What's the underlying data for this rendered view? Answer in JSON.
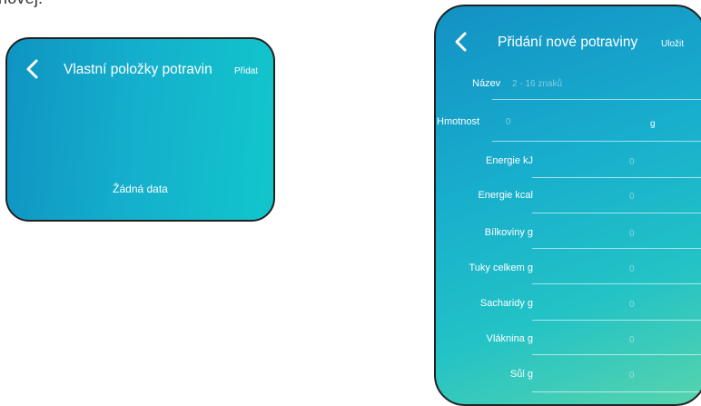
{
  "caption": "novej.",
  "left_screen": {
    "back_icon": "chevron-left-icon",
    "title": "Vlastní položky potravin",
    "action": "Přidat",
    "empty_message": "Žádná data"
  },
  "right_screen": {
    "back_icon": "chevron-left-icon",
    "title": "Přidání nové potraviny",
    "action": "Uložit",
    "name_field": {
      "label": "Název",
      "placeholder": "2 - 16 znaků"
    },
    "weight_field": {
      "label": "Hmotnost",
      "value": "0",
      "unit": "g"
    },
    "nutrients": [
      {
        "label": "Energie kJ",
        "value": "0"
      },
      {
        "label": "Energie kcal",
        "value": "0"
      },
      {
        "label": "Bílkoviny g",
        "value": "0"
      },
      {
        "label": "Tuky celkem g",
        "value": "0"
      },
      {
        "label": "Sacharidy g",
        "value": "0"
      },
      {
        "label": "Vláknina g",
        "value": "0"
      },
      {
        "label": "Sůl g",
        "value": "0"
      }
    ]
  },
  "colors": {
    "gradient_start": "#1391c4",
    "gradient_mid": "#18aecd",
    "gradient_end": "#57d4ad",
    "text": "#ffffff",
    "border": "#222222"
  }
}
